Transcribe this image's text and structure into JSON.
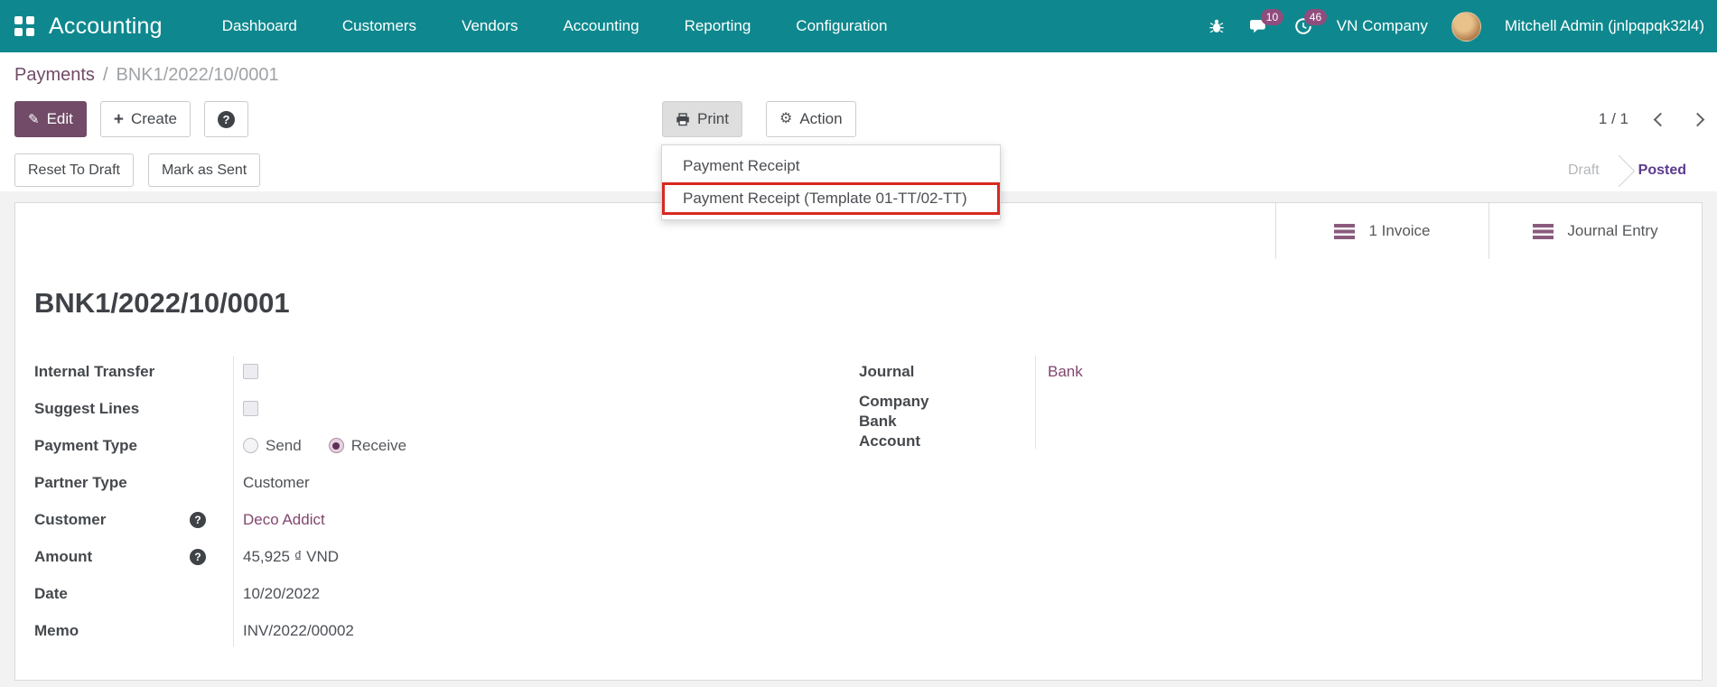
{
  "nav": {
    "app_name": "Accounting",
    "menus": [
      "Dashboard",
      "Customers",
      "Vendors",
      "Accounting",
      "Reporting",
      "Configuration"
    ],
    "message_badge": "10",
    "activity_badge": "46",
    "company": "VN Company",
    "user": "Mitchell Admin (jnlpqpqk32l4)"
  },
  "breadcrumb": {
    "parent": "Payments",
    "separator": "/",
    "current": "BNK1/2022/10/0001"
  },
  "actions": {
    "edit": "Edit",
    "create": "Create",
    "print": "Print",
    "action": "Action",
    "pager": "1 / 1"
  },
  "workflow": {
    "reset_to_draft": "Reset To Draft",
    "mark_as_sent": "Mark as Sent",
    "status_draft": "Draft",
    "status_posted": "Posted"
  },
  "print_menu": {
    "items": [
      {
        "label": "Payment Receipt",
        "highlighted": false
      },
      {
        "label": "Payment Receipt (Template 01-TT/02-TT)",
        "highlighted": true
      }
    ]
  },
  "stat_buttons": {
    "invoice": "1 Invoice",
    "journal_entry": "Journal Entry"
  },
  "form": {
    "title": "BNK1/2022/10/0001",
    "internal_transfer_label": "Internal Transfer",
    "suggest_lines_label": "Suggest Lines",
    "payment_type_label": "Payment Type",
    "payment_type_send": "Send",
    "payment_type_receive": "Receive",
    "payment_type_selected": "Receive",
    "partner_type_label": "Partner Type",
    "partner_type_value": "Customer",
    "customer_label": "Customer",
    "customer_value": "Deco Addict",
    "amount_label": "Amount",
    "amount_value": "45,925 ₫ VND",
    "date_label": "Date",
    "date_value": "10/20/2022",
    "memo_label": "Memo",
    "memo_value": "INV/2022/00002",
    "journal_label": "Journal",
    "journal_value": "Bank",
    "company_bank_account_label": "Company Bank Account"
  },
  "icons": {
    "help": "?",
    "pencil": "✎",
    "plus": "+",
    "gear": "⚙"
  },
  "colors": {
    "nav_bar": "#0e888e",
    "badge": "#8f4d7e",
    "primary": "#714B67",
    "link": "#82466f",
    "status_posted": "#5b3a8e",
    "highlight_border": "#d8291f"
  }
}
